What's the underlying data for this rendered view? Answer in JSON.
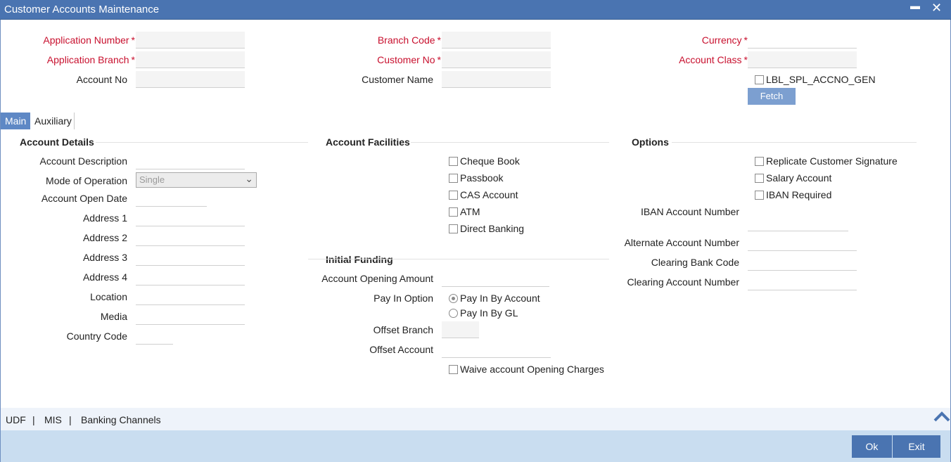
{
  "window": {
    "title": "Customer Accounts Maintenance",
    "minimize": "▬",
    "close": "✕"
  },
  "header": {
    "application_number": "Application Number",
    "application_branch": "Application Branch",
    "account_no": "Account No",
    "branch_code": "Branch Code",
    "customer_no": "Customer No",
    "customer_name": "Customer Name",
    "currency": "Currency",
    "account_class": "Account Class",
    "spl_accno_gen": "LBL_SPL_ACCNO_GEN",
    "fetch": "Fetch",
    "required_mark": "*"
  },
  "tabs": [
    {
      "label": "Main"
    },
    {
      "label": "Auxiliary"
    }
  ],
  "account_details": {
    "title": "Account Details",
    "account_description": "Account Description",
    "mode_of_operation": "Mode of Operation",
    "mode_value": "Single",
    "account_open_date": "Account Open Date",
    "address1": "Address 1",
    "address2": "Address 2",
    "address3": "Address 3",
    "address4": "Address 4",
    "location": "Location",
    "media": "Media",
    "country_code": "Country Code"
  },
  "account_facilities": {
    "title": "Account Facilities",
    "cheque_book": "Cheque Book",
    "passbook": "Passbook",
    "cas_account": "CAS Account",
    "atm": "ATM",
    "direct_banking": "Direct Banking"
  },
  "initial_funding": {
    "title": "Initial Funding",
    "opening_amount": "Account Opening Amount",
    "pay_in_option": "Pay In Option",
    "pay_in_by_account": "Pay In By Account",
    "pay_in_by_gl": "Pay In By GL",
    "selected_option": "Pay In By Account",
    "offset_branch": "Offset Branch",
    "offset_account": "Offset Account",
    "waive_charges": "Waive account Opening Charges"
  },
  "options": {
    "title": "Options",
    "replicate_signature": "Replicate Customer Signature",
    "salary_account": "Salary Account",
    "iban_required": "IBAN Required",
    "iban_account_number": "IBAN Account Number",
    "alternate_account_number": "Alternate Account Number",
    "clearing_bank_code": "Clearing Bank Code",
    "clearing_account_number": "Clearing Account Number"
  },
  "bottom_links": {
    "udf": "UDF",
    "mis": "MIS",
    "banking_channels": "Banking Channels",
    "separator": "|"
  },
  "footer": {
    "ok": "Ok",
    "exit": "Exit"
  },
  "colors": {
    "titlebar": "#4a74b1",
    "required_label": "#c8102e",
    "footer": "#c9ddf0",
    "button": "#4a74b1"
  }
}
